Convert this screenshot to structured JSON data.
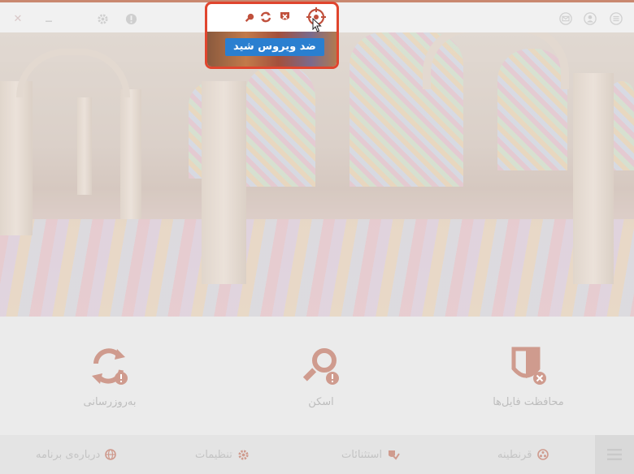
{
  "popup": {
    "button_label": "ضد ویروس شید"
  },
  "features": {
    "update_label": "بەروزرسانی",
    "scan_label": "اسکن",
    "protection_label": "محافظت فایل‌ها"
  },
  "nav": {
    "about_label": "دربارەی برنامه",
    "settings_label": "تنظیمات",
    "exclusions_label": "استثنائات",
    "quarantine_label": "قرنطینه"
  },
  "colors": {
    "highlight": "#e0452e",
    "accent_icon": "#c0503c",
    "button_blue": "#2a7fd0",
    "top_accent": "#c98870"
  },
  "icons": [
    "close-icon",
    "minimize-icon",
    "gear-icon",
    "info-icon",
    "mail-icon",
    "user-icon",
    "menu-icon",
    "search-icon",
    "sync-icon",
    "shield-icon",
    "target-icon",
    "cursor-icon"
  ]
}
